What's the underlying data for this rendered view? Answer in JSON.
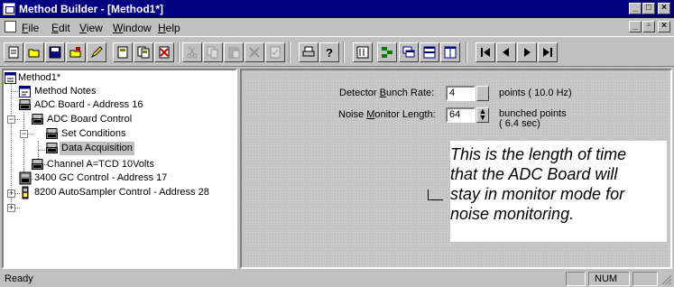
{
  "window": {
    "title": "Method Builder - [Method1*]"
  },
  "menu": [
    {
      "label": "File",
      "accel": "F"
    },
    {
      "label": "Edit",
      "accel": "E"
    },
    {
      "label": "View",
      "accel": "V"
    },
    {
      "label": "Window",
      "accel": "W"
    },
    {
      "label": "Help",
      "accel": "H"
    }
  ],
  "toolbar": {
    "buttons": [
      {
        "name": "new",
        "icon": "new-file-icon"
      },
      {
        "name": "open",
        "icon": "open-folder-icon"
      },
      {
        "name": "save",
        "icon": "save-disk-icon"
      },
      {
        "name": "open-method",
        "icon": "open-method-icon"
      },
      {
        "name": "edit",
        "icon": "pencil-icon"
      },
      {
        "name": "method-new",
        "icon": "method-new-icon"
      },
      {
        "name": "method-copy",
        "icon": "method-copy-icon"
      },
      {
        "name": "method-delete",
        "icon": "method-delete-icon"
      },
      {
        "name": "cut",
        "icon": "cut-icon"
      },
      {
        "name": "copy",
        "icon": "copy-icon"
      },
      {
        "name": "paste",
        "icon": "paste-icon"
      },
      {
        "name": "delete",
        "icon": "delete-icon"
      },
      {
        "name": "properties",
        "icon": "properties-icon"
      },
      {
        "name": "print",
        "icon": "print-icon"
      },
      {
        "name": "help",
        "icon": "help-icon"
      },
      {
        "name": "view-1",
        "icon": "view-list-icon"
      },
      {
        "name": "view-2",
        "icon": "view-tree-icon"
      },
      {
        "name": "view-3",
        "icon": "view-cascade-icon"
      },
      {
        "name": "view-4",
        "icon": "view-split-icon"
      },
      {
        "name": "view-5",
        "icon": "view-panel-icon"
      },
      {
        "name": "first",
        "icon": "first-icon"
      },
      {
        "name": "prev",
        "icon": "previous-icon"
      },
      {
        "name": "next",
        "icon": "next-icon"
      },
      {
        "name": "last",
        "icon": "last-icon"
      }
    ]
  },
  "tree": {
    "root": "Method1*",
    "method_notes": "Method Notes",
    "adc_board": "ADC Board - Address 16",
    "adc_board_control": "ADC Board Control",
    "set_conditions": "Set Conditions",
    "data_acquisition": "Data Acquisition",
    "channel_a": "Channel A=TCD 10Volts",
    "gc_control": "3400 GC Control - Address 17",
    "autosampler": "8200 AutoSampler Control - Address 28"
  },
  "form": {
    "bunch_rate_label_pre": "Detector ",
    "bunch_rate_label_accel": "B",
    "bunch_rate_label_post": "unch Rate:",
    "bunch_rate_value": "4",
    "bunch_rate_units": "points ( 10.0 Hz)",
    "noise_label_pre": "Noise ",
    "noise_label_accel": "M",
    "noise_label_post": "onitor Length:",
    "noise_value": "64",
    "noise_units_1": "bunched points",
    "noise_units_2": "( 6.4 sec)"
  },
  "callout": {
    "line1": "This is the length of time",
    "line2": "that the ADC Board will",
    "line3": "stay in monitor mode for",
    "line4": "noise monitoring."
  },
  "status": {
    "text": "Ready",
    "num": "NUM"
  }
}
